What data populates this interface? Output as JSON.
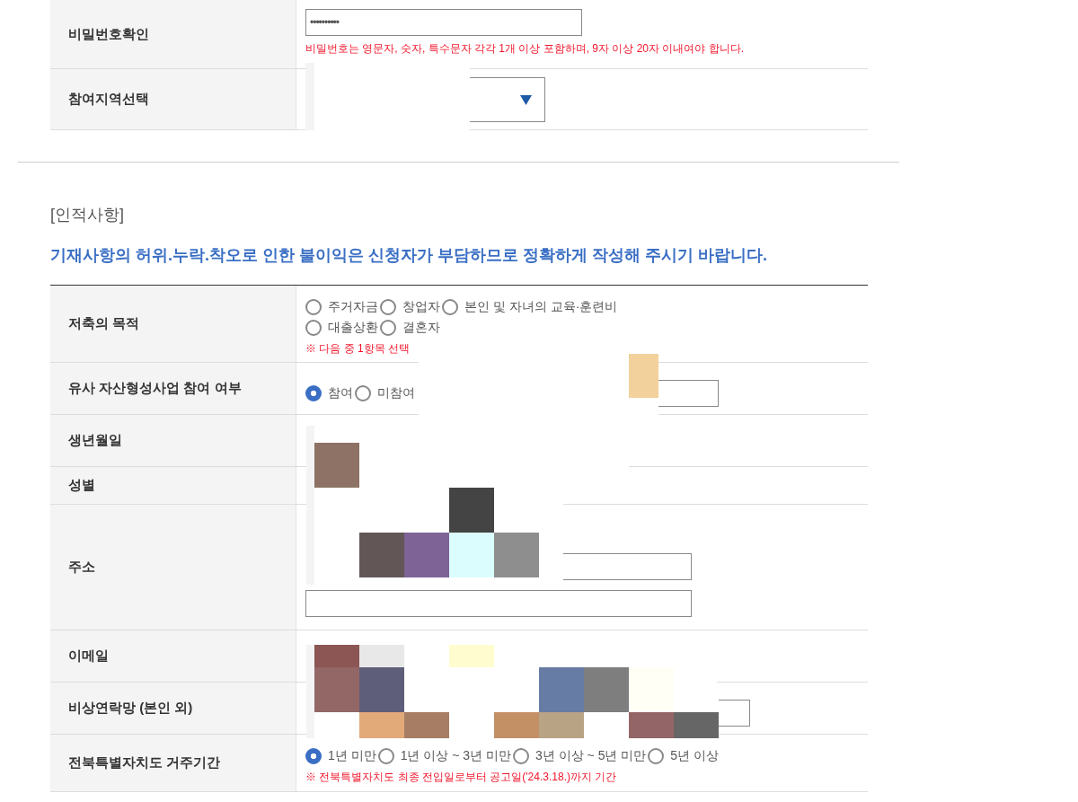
{
  "account": {
    "rows": [
      {
        "label": "비밀번호확인",
        "kind": "password",
        "value": "••••••••••",
        "hint": "비밀번호는 영문자, 숫자, 특수문자 각각 1개 이상 포함하며, 9자 이상 20자 이내여야 합니다."
      },
      {
        "label": "참여지역선택",
        "kind": "select"
      }
    ]
  },
  "personal": {
    "section_title": "[인적사항]",
    "notice": "기재사항의 허위.누락.착오로 인한 불이익은 신청자가 부담하므로 정확하게 작성해 주시기 바랍니다.",
    "rows": [
      {
        "label": "저축의 목적",
        "kind": "radio",
        "options": [
          {
            "label": "주거자금",
            "selected": false
          },
          {
            "label": "창업자",
            "selected": false
          },
          {
            "label": "본인 및 자녀의 교육·훈련비",
            "selected": false
          },
          {
            "label": "대출상환",
            "selected": false
          },
          {
            "label": "결혼자",
            "selected": false
          }
        ],
        "note": "※ 다음 중 1항목 선택"
      },
      {
        "label": "유사 자산형성사업 참여 여부",
        "kind": "radio",
        "field": true,
        "options": [
          {
            "label": "참여",
            "selected": true
          },
          {
            "label": "미참여",
            "selected": false
          }
        ]
      },
      {
        "label": "생년월일",
        "kind": "blank"
      },
      {
        "label": "성별",
        "kind": "blank"
      },
      {
        "label": "주소",
        "kind": "address"
      },
      {
        "label": "이메일",
        "kind": "blank"
      },
      {
        "label": "비상연락망 (본인 외)",
        "kind": "wide"
      },
      {
        "label": "전북특별자치도 거주기간",
        "kind": "radio",
        "options": [
          {
            "label": "1년 미만",
            "selected": true
          },
          {
            "label": "1년 이상 ~ 3년 미만",
            "selected": false
          },
          {
            "label": "3년 이상 ~ 5년 미만",
            "selected": false
          },
          {
            "label": "5년 이상",
            "selected": false
          }
        ],
        "note": "※ 전북특별자치도 최종 전입일로부터 공고일('24.3.18.)까지 기간"
      }
    ]
  }
}
